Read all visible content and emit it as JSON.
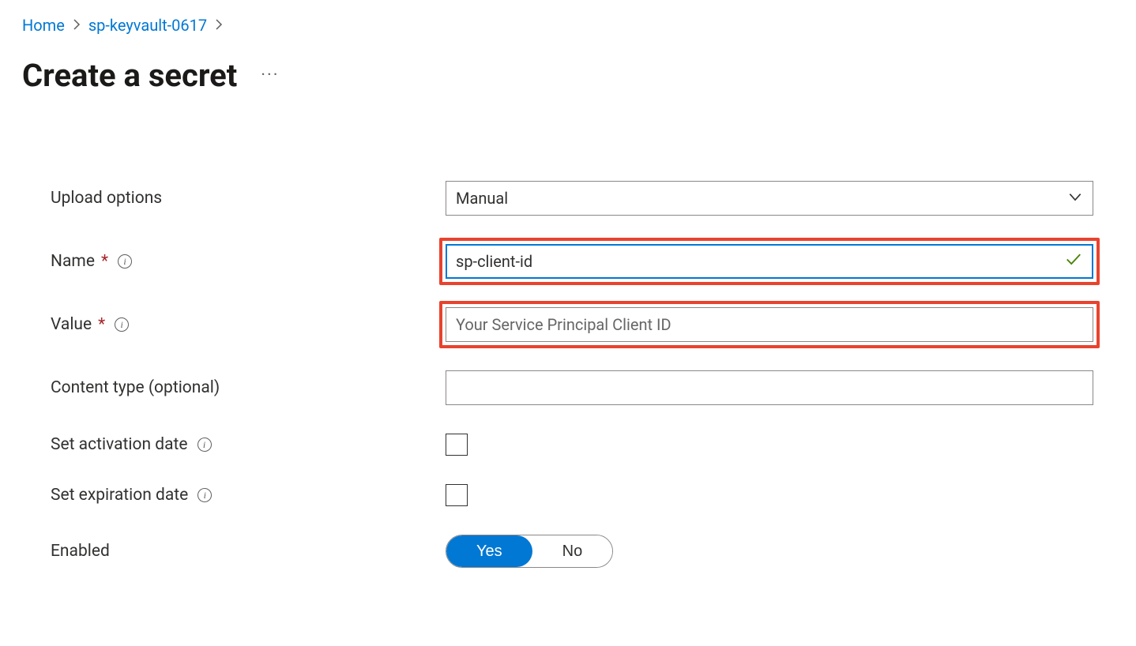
{
  "breadcrumb": {
    "home": "Home",
    "resource": "sp-keyvault-0617"
  },
  "page_title": "Create a secret",
  "form": {
    "upload_options": {
      "label": "Upload options",
      "value": "Manual"
    },
    "name": {
      "label": "Name",
      "value": "sp-client-id"
    },
    "value": {
      "label": "Value",
      "placeholder": "Your Service Principal Client ID"
    },
    "content_type": {
      "label": "Content type (optional)",
      "value": ""
    },
    "activation_date": {
      "label": "Set activation date"
    },
    "expiration_date": {
      "label": "Set expiration date"
    },
    "enabled": {
      "label": "Enabled",
      "yes": "Yes",
      "no": "No",
      "selected": "Yes"
    }
  }
}
